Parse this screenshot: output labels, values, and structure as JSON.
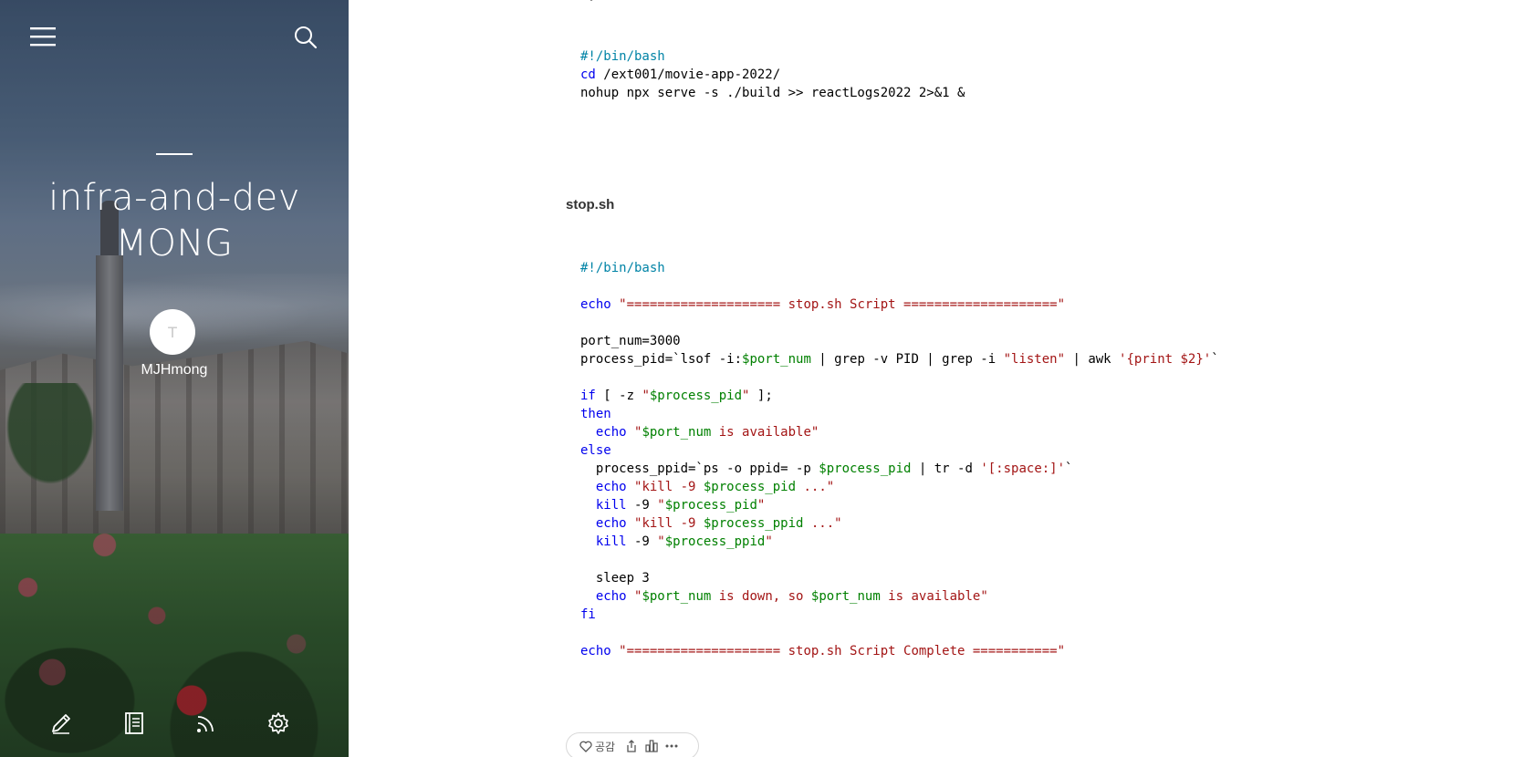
{
  "sidebar": {
    "title_line1": "infra-and-dev",
    "title_line2": "MONG",
    "author": "MJHmong",
    "avatar_initial": "T",
    "icons": {
      "menu": "hamburger-menu-icon",
      "search": "search-icon",
      "write": "pencil-icon",
      "blog": "book-icon",
      "rss": "rss-icon",
      "settings": "gear-icon"
    }
  },
  "post": {
    "start_code": [
      "#!/bin/bash",
      "cd /ext001/movie-app-2022/",
      "nohup npx serve -s ./build >> reactLogs2022 2>&1 &"
    ],
    "stop_heading": "stop.sh",
    "stop_code": [
      "#!/bin/bash",
      "",
      "echo \"==================== stop.sh Script ====================\"",
      "",
      "port_num=3000",
      "process_pid=`lsof -i:$port_num | grep -v PID | grep -i \"listen\" | awk '{print $2}'`",
      "",
      "if [ -z \"$process_pid\" ];",
      "then",
      "  echo \"$port_num is available\"",
      "else",
      "  process_ppid=`ps -o ppid= -p $process_pid | tr -d '[:space:]'`",
      "  echo \"kill -9 $process_pid ...\"",
      "  kill -9 \"$process_pid\"",
      "  echo \"kill -9 $process_ppid ...\"",
      "  kill -9 \"$process_ppid\"",
      "",
      "  sleep 3",
      "  echo \"$port_num is down, so $port_num is available\"",
      "fi",
      "",
      "echo \"==================== stop.sh Script Complete ===========\""
    ]
  },
  "reactions": {
    "like_label": "공감",
    "icons": [
      "heart-icon",
      "share-icon",
      "stats-icon",
      "more-icon"
    ]
  },
  "colors": {
    "keyword": "#0000ee",
    "shebang": "#0083a6",
    "string": "#a31515",
    "variable": "#008000"
  }
}
